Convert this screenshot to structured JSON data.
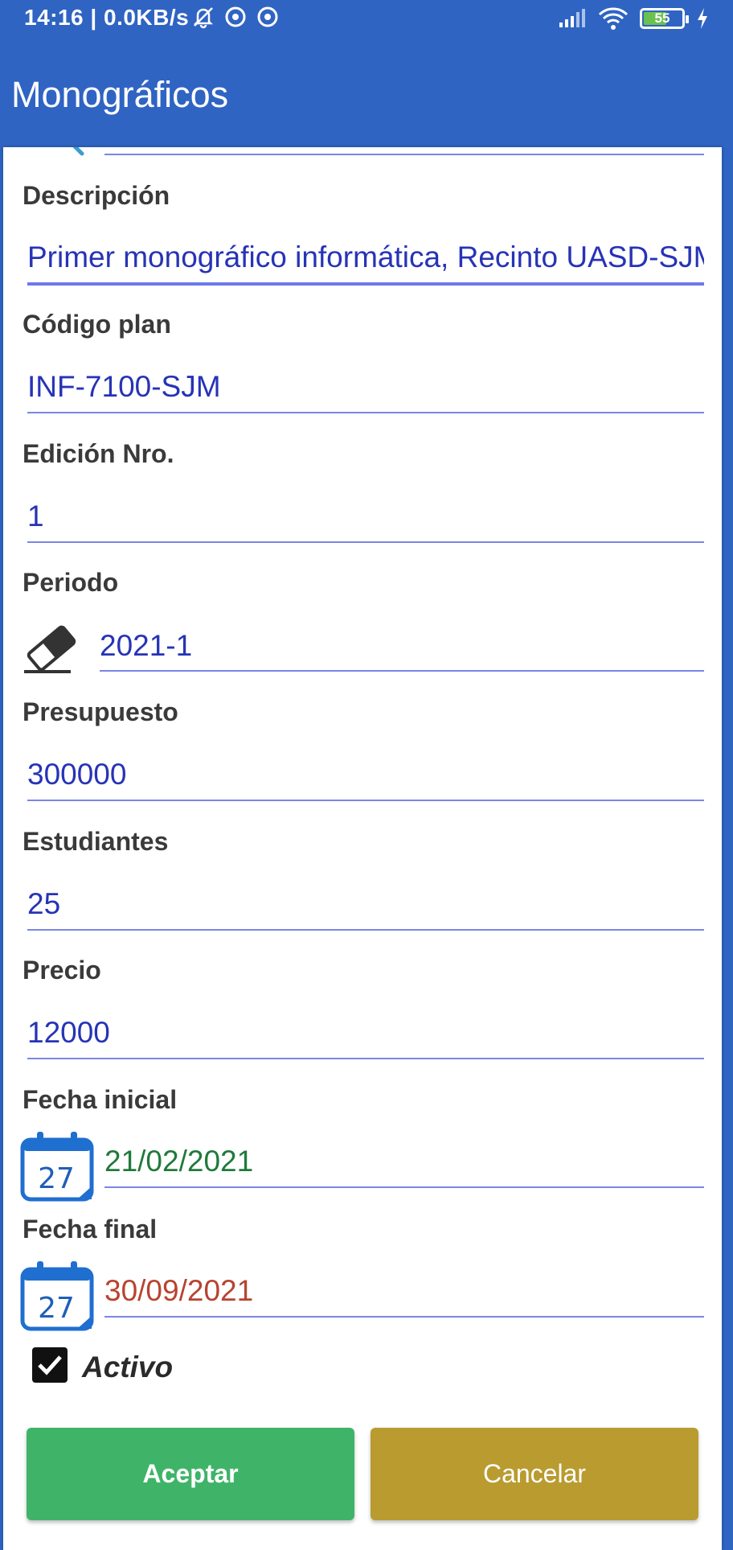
{
  "status_bar": {
    "time": "14:16 | 0.0KB/s",
    "battery": "55"
  },
  "app": {
    "title": "Monográficos"
  },
  "fields": {
    "descripcion": {
      "label": "Descripción",
      "value": "Primer monográfico informática, Recinto UASD-SJM"
    },
    "codigo_plan": {
      "label": "Código plan",
      "value": "INF-7100-SJM"
    },
    "edicion": {
      "label": "Edición Nro.",
      "value": "1"
    },
    "periodo": {
      "label": "Periodo",
      "value": "2021-1"
    },
    "presupuesto": {
      "label": "Presupuesto",
      "value": "300000"
    },
    "estudiantes": {
      "label": "Estudiantes",
      "value": "25"
    },
    "precio": {
      "label": "Precio",
      "value": "12000"
    },
    "fecha_inicial": {
      "label": "Fecha inicial",
      "value": "21/02/2021",
      "color": "#1f7a3a"
    },
    "fecha_final": {
      "label": "Fecha final",
      "value": "30/09/2021",
      "color": "#b8432f"
    }
  },
  "calendar_day": "27",
  "activo": {
    "label": "Activo",
    "checked": true
  },
  "buttons": {
    "accept": "Aceptar",
    "cancel": "Cancelar"
  },
  "colors": {
    "primary": "#2f64c3",
    "value_text": "#2733b6",
    "accept": "#3fb469",
    "cancel": "#b99b30"
  }
}
